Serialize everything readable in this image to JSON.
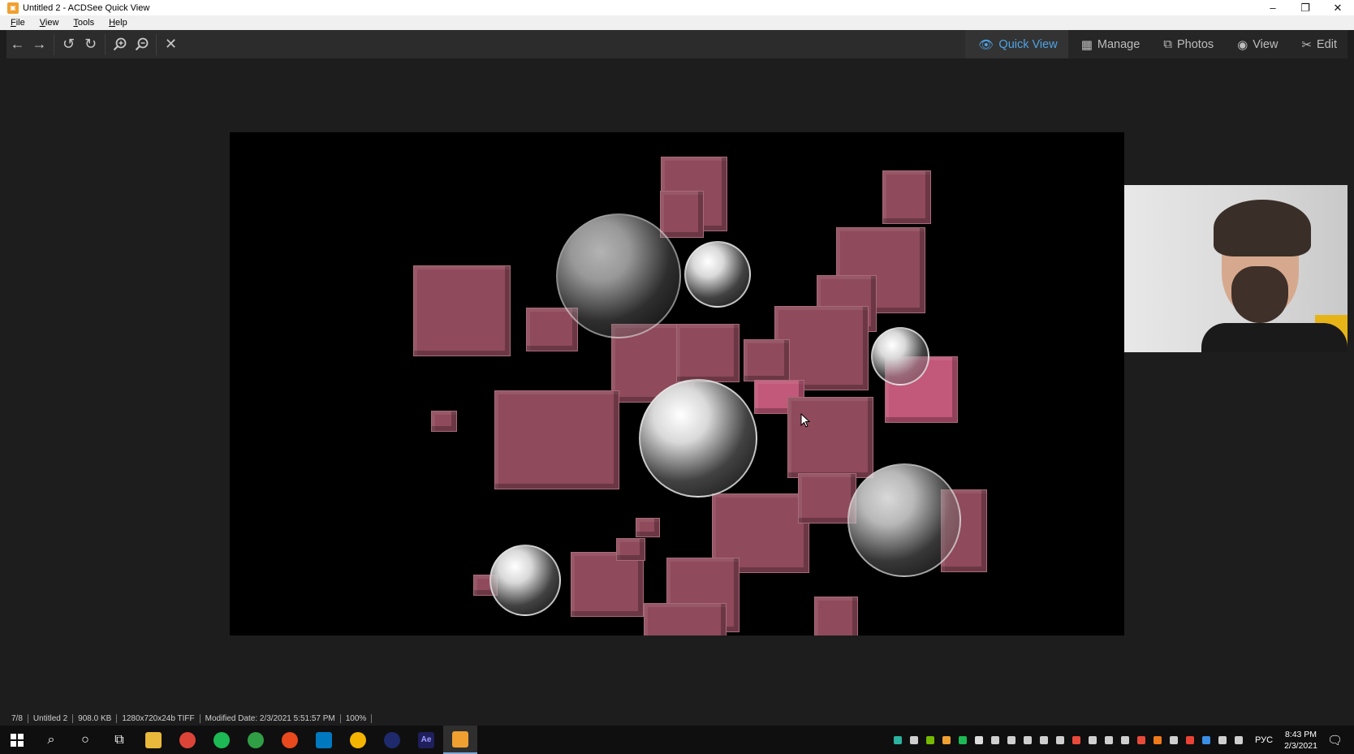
{
  "window": {
    "title": "Untitled 2 - ACDSee Quick View",
    "app_icon": "acdsee-icon",
    "controls": [
      "minimize-icon",
      "restore-icon",
      "close-icon"
    ]
  },
  "menu": {
    "items": [
      "File",
      "View",
      "Tools",
      "Help"
    ]
  },
  "toolbar": {
    "buttons": [
      "back-arrow-icon",
      "forward-arrow-icon",
      "rotate-left-icon",
      "rotate-right-icon",
      "zoom-in-icon",
      "zoom-out-icon",
      "close-icon"
    ],
    "modes": [
      {
        "label": "Quick View",
        "icon": "eye-icon",
        "active": true
      },
      {
        "label": "Manage",
        "icon": "grid-icon",
        "active": false
      },
      {
        "label": "Photos",
        "icon": "photos-icon",
        "active": false
      },
      {
        "label": "View",
        "icon": "eye-icon",
        "active": false
      },
      {
        "label": "Edit",
        "icon": "edit-tools-icon",
        "active": false
      }
    ],
    "active_color": "#4fa3e6"
  },
  "status": {
    "index": "7/8",
    "filename": "Untitled 2",
    "filesize": "908.0 KB",
    "dimensions": "1280x720x24b TIFF",
    "modified": "Modified Date: 2/3/2021 5:51:57 PM",
    "zoom": "100%"
  },
  "taskbar": {
    "apps": [
      "start-icon",
      "search-icon",
      "cortana-icon",
      "task-view-icon",
      "file-explorer-icon",
      "chrome-icon",
      "spotify-icon",
      "green-app-icon",
      "media-player-icon",
      "trello-icon",
      "chrome-alt-icon",
      "cinema4d-icon",
      "after-effects-icon",
      "acdsee-icon"
    ],
    "ae_label": "Ae",
    "language": "РУС",
    "time": "8:43 PM",
    "date": "2/3/2021"
  }
}
